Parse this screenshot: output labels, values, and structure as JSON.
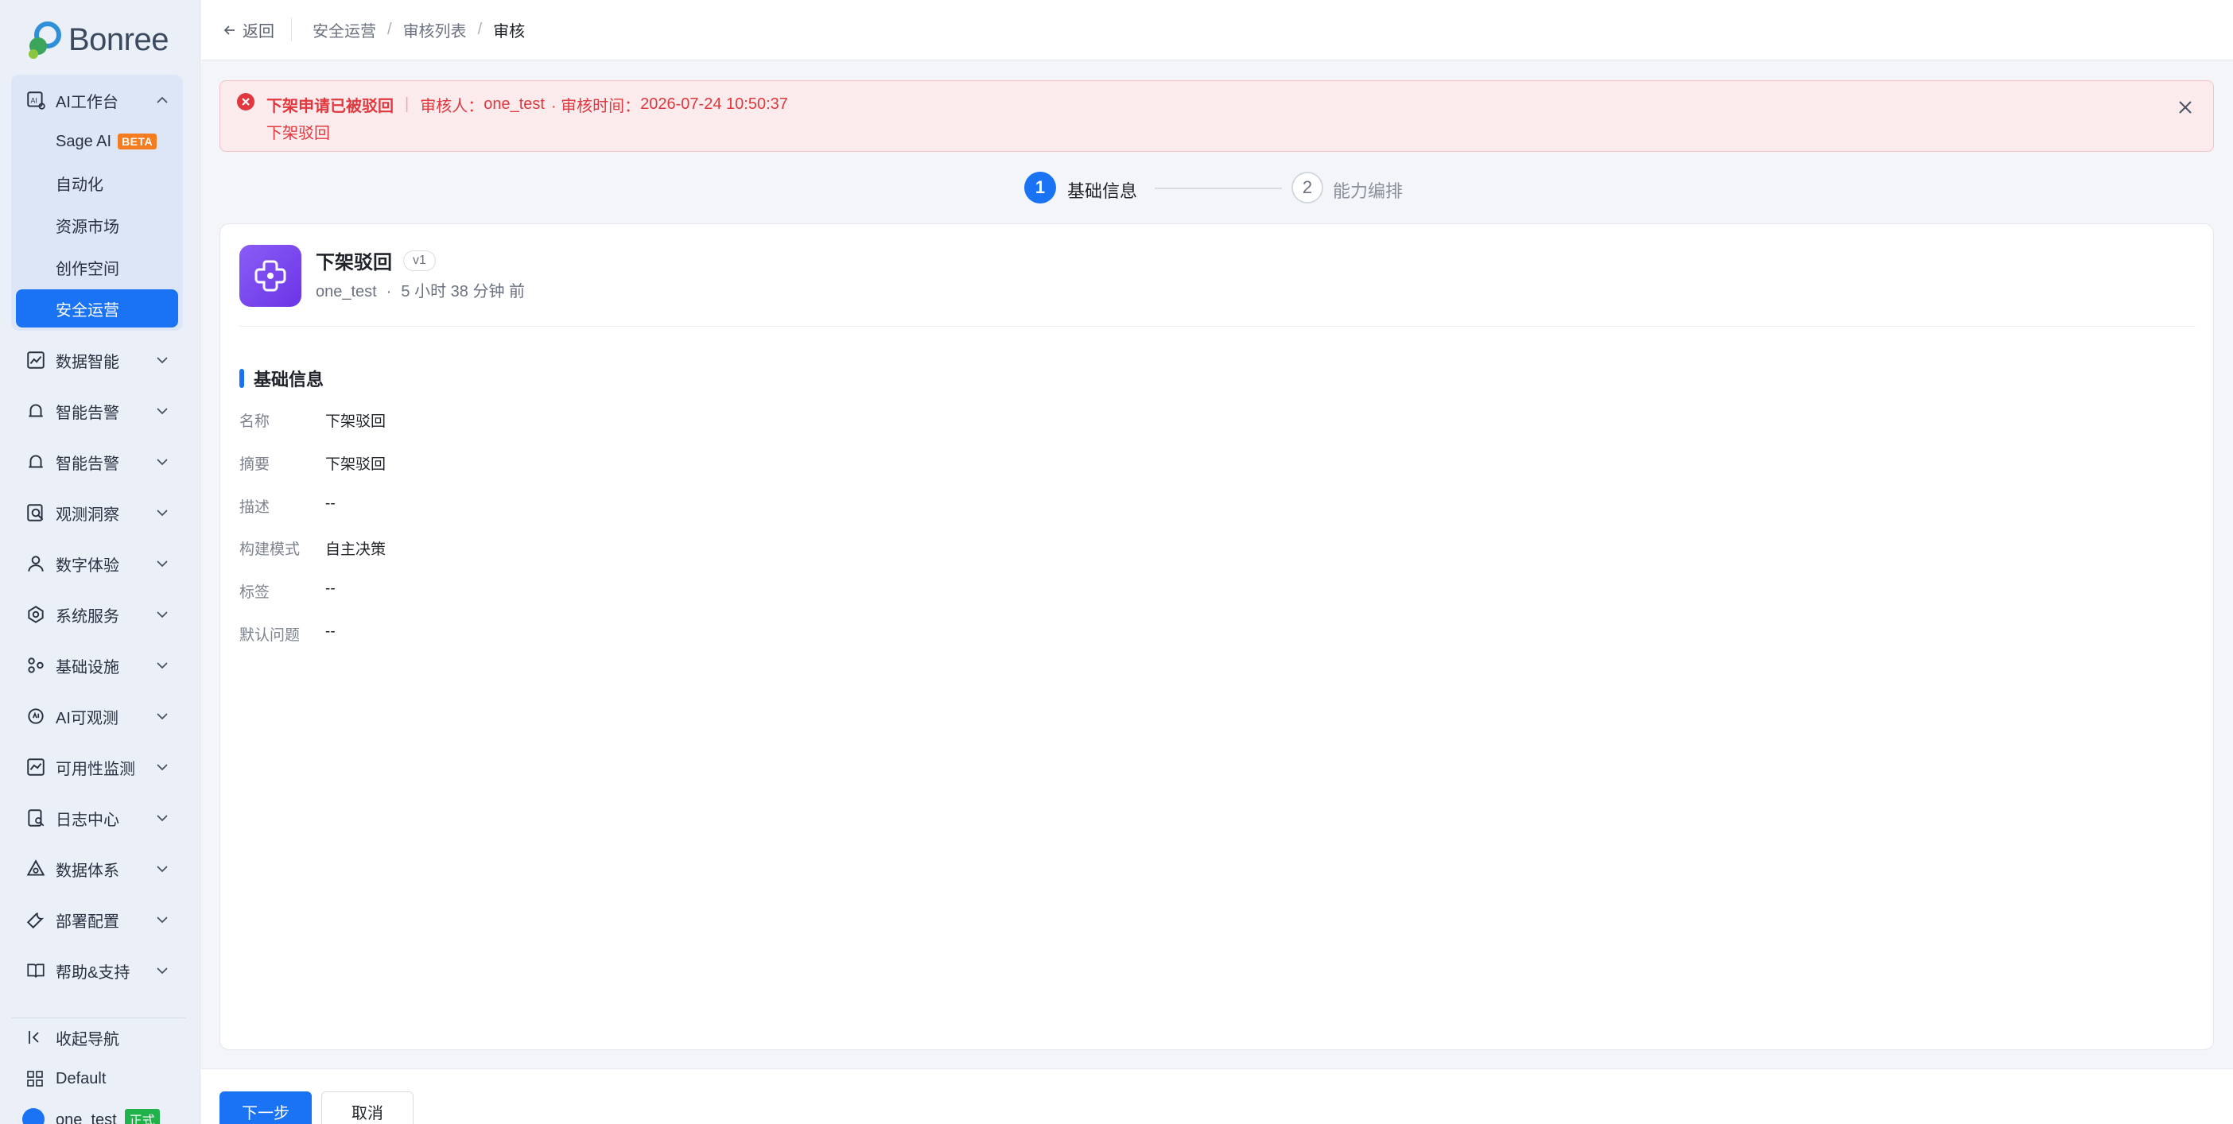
{
  "brand": {
    "logo_text": "Bonree"
  },
  "sidebar": {
    "groups": [
      {
        "label": "AI工作台",
        "icon": "ai-workbench-icon",
        "expanded": true
      },
      {
        "label": "数据智能",
        "icon": "chart-icon"
      },
      {
        "label": "智能告警",
        "icon": "alarm-icon"
      },
      {
        "label": "智能告警",
        "icon": "alarm-icon"
      },
      {
        "label": "观测洞察",
        "icon": "search-doc-icon"
      },
      {
        "label": "数字体验",
        "icon": "user-icon"
      },
      {
        "label": "系统服务",
        "icon": "service-icon"
      },
      {
        "label": "基础设施",
        "icon": "infra-icon"
      },
      {
        "label": "AI可观测",
        "icon": "ai-observe-icon"
      },
      {
        "label": "可用性监测",
        "icon": "monitor-icon"
      },
      {
        "label": "日志中心",
        "icon": "log-icon"
      },
      {
        "label": "数据体系",
        "icon": "data-system-icon"
      },
      {
        "label": "部署配置",
        "icon": "wrench-icon"
      },
      {
        "label": "帮助&支持",
        "icon": "book-icon"
      }
    ],
    "sub_items": [
      {
        "label": "Sage AI",
        "badge": "BETA"
      },
      {
        "label": "自动化"
      },
      {
        "label": "资源市场"
      },
      {
        "label": "创作空间"
      },
      {
        "label": "安全运营",
        "active": true
      }
    ],
    "collapse_label": "收起导航",
    "workspace_label": "Default",
    "user": {
      "name": "one_test",
      "badge": "正式"
    }
  },
  "topbar": {
    "back_label": "返回",
    "breadcrumbs": [
      "安全运营",
      "审核列表",
      "审核"
    ]
  },
  "alert": {
    "title": "下架申请已被驳回",
    "reviewer_prefix": "审核人：",
    "reviewer": "one_test",
    "time_prefix": "· 审核时间：",
    "time": "2026-07-24 10:50:37",
    "reason": "下架驳回"
  },
  "steps": [
    {
      "num": "1",
      "label": "基础信息",
      "active": true
    },
    {
      "num": "2",
      "label": "能力编排",
      "active": false
    }
  ],
  "app": {
    "name": "下架驳回",
    "version": "v1",
    "owner": "one_test",
    "updated": "5 小时 38 分钟 前"
  },
  "section": {
    "title": "基础信息",
    "fields": [
      {
        "key": "名称",
        "value": "下架驳回"
      },
      {
        "key": "摘要",
        "value": "下架驳回"
      },
      {
        "key": "描述",
        "value": "--"
      },
      {
        "key": "构建模式",
        "value": "自主决策"
      },
      {
        "key": "标签",
        "value": "--"
      },
      {
        "key": "默认问题",
        "value": "--"
      }
    ]
  },
  "footer": {
    "next_label": "下一步",
    "cancel_label": "取消"
  },
  "colors": {
    "accent": "#1a73f5",
    "error": "#e0383e",
    "app_icon": "#7c4dff"
  }
}
